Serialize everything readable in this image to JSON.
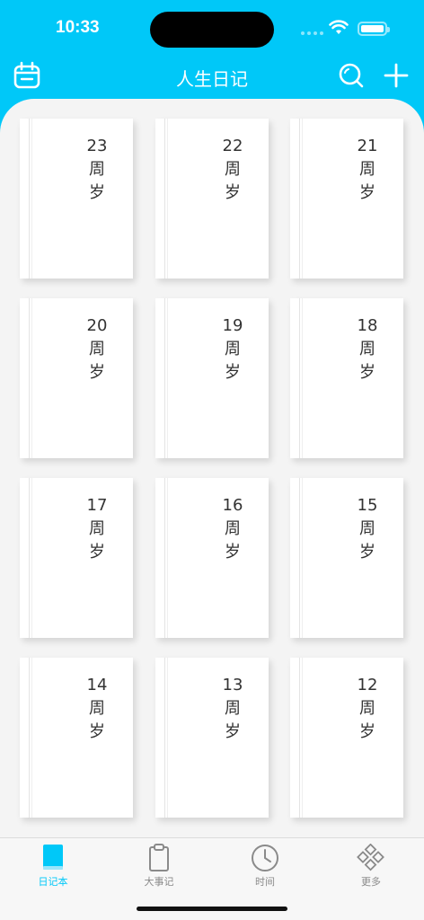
{
  "status": {
    "time": "10:33"
  },
  "nav": {
    "title": "人生日记",
    "left_icon": "calendar-icon",
    "right_icons": [
      "search-icon",
      "plus-icon"
    ]
  },
  "colors": {
    "accent": "#00c8f8",
    "background": "#f4f4f4",
    "tabbar": "#f7f7f7"
  },
  "books": [
    {
      "number": "23",
      "word1": "周",
      "word2": "岁"
    },
    {
      "number": "22",
      "word1": "周",
      "word2": "岁"
    },
    {
      "number": "21",
      "word1": "周",
      "word2": "岁"
    },
    {
      "number": "20",
      "word1": "周",
      "word2": "岁"
    },
    {
      "number": "19",
      "word1": "周",
      "word2": "岁"
    },
    {
      "number": "18",
      "word1": "周",
      "word2": "岁"
    },
    {
      "number": "17",
      "word1": "周",
      "word2": "岁"
    },
    {
      "number": "16",
      "word1": "周",
      "word2": "岁"
    },
    {
      "number": "15",
      "word1": "周",
      "word2": "岁"
    },
    {
      "number": "14",
      "word1": "周",
      "word2": "岁"
    },
    {
      "number": "13",
      "word1": "周",
      "word2": "岁"
    },
    {
      "number": "12",
      "word1": "周",
      "word2": "岁"
    }
  ],
  "tabs": [
    {
      "label": "日记本",
      "icon": "notebook-icon",
      "active": true
    },
    {
      "label": "大事记",
      "icon": "clipboard-icon",
      "active": false
    },
    {
      "label": "时间",
      "icon": "clock-icon",
      "active": false
    },
    {
      "label": "更多",
      "icon": "more-grid-icon",
      "active": false
    }
  ]
}
